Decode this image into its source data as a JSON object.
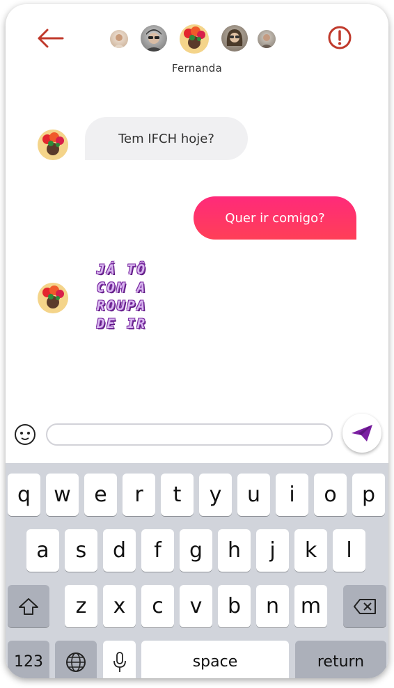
{
  "header": {
    "contact_name": "Fernanda",
    "back_icon": "arrow-left-icon",
    "alert_icon": "alert-circle-icon",
    "accent_color": "#c0392b"
  },
  "messages": [
    {
      "direction": "incoming",
      "type": "text",
      "text": "Tem IFCH hoje?"
    },
    {
      "direction": "outgoing",
      "type": "text",
      "text": "Quer ir comigo?"
    },
    {
      "direction": "incoming",
      "type": "sticker",
      "lines": [
        "JÁ TÔ",
        "COM A",
        "ROUPA",
        "DE IR"
      ]
    }
  ],
  "composer": {
    "input_value": "",
    "input_placeholder": "",
    "emoji_icon": "emoji-face-icon",
    "send_icon": "send-plane-icon",
    "send_color": "#7b1fa2"
  },
  "keyboard": {
    "row1": [
      "q",
      "w",
      "e",
      "r",
      "t",
      "y",
      "u",
      "i",
      "o",
      "p"
    ],
    "row2": [
      "a",
      "s",
      "d",
      "f",
      "g",
      "h",
      "j",
      "k",
      "l"
    ],
    "row3": [
      "z",
      "x",
      "c",
      "v",
      "b",
      "n",
      "m"
    ],
    "numbers_label": "123",
    "space_label": "space",
    "return_label": "return"
  },
  "colors": {
    "outgoing_bubble": "#ff2d6e",
    "incoming_bubble": "#f0f0f2",
    "keyboard_bg": "#d1d4db"
  }
}
